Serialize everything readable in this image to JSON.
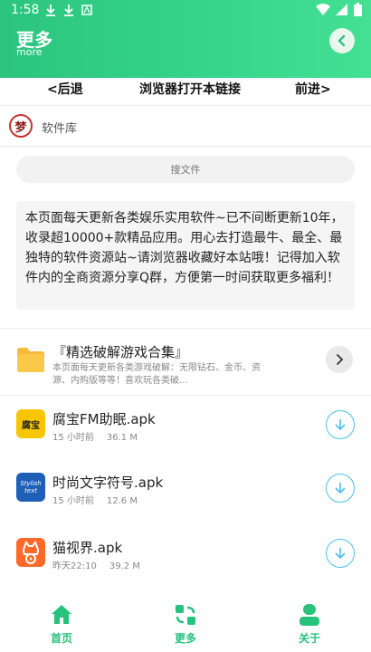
{
  "status_bar": {
    "time": "1:58"
  },
  "header": {
    "title": "更多",
    "subtitle": "more"
  },
  "nav": {
    "back": "<后退",
    "open_in_browser": "浏览器打开本链接",
    "forward": "前进>"
  },
  "site": {
    "logo_text": "梦",
    "name": "软件库"
  },
  "search": {
    "placeholder": "搜文件"
  },
  "notice": {
    "text": "本页面每天更新各类娱乐实用软件~已不间断更新10年，收录超10000+款精品应用。用心去打造最牛、最全、最独特的软件资源站~请浏览器收藏好本站哦！记得加入软件内的全商资源分享Q群，方便第一时间获取更多福利！"
  },
  "folder": {
    "title": "『精选破解游戏合集』",
    "description": "本页面每天更新各类游戏破解：无限钻石、金币、资源、内购版等等！喜欢玩各类破..."
  },
  "files": [
    {
      "name": "腐宝FM助眠.apk",
      "time": "15 小时前",
      "size": "36.1 M",
      "icon_text": "腐宝"
    },
    {
      "name": "时尚文字符号.apk",
      "time": "15 小时前",
      "size": "12.6 M",
      "icon_text": "Stylish text"
    },
    {
      "name": "猫视界.apk",
      "time": "昨天22:10",
      "size": "39.2 M",
      "icon_text": ""
    }
  ],
  "tabs": {
    "home": "首页",
    "more": "更多",
    "about": "关于"
  },
  "colors": {
    "accent": "#27c27b",
    "download": "#49c1ea"
  }
}
